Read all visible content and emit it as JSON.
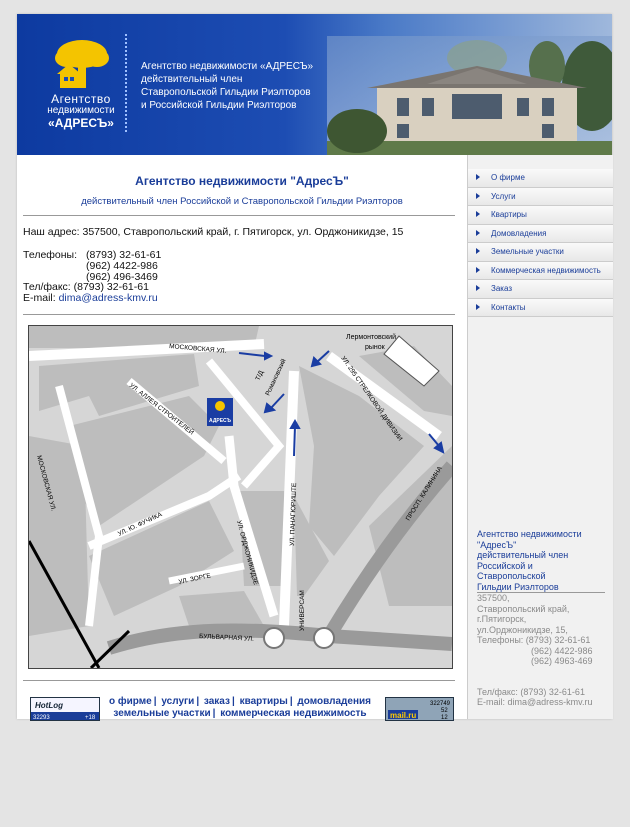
{
  "header": {
    "logo_line1": "Агентство",
    "logo_line2": "недвижимости",
    "logo_line3": "«АДРЕСЪ»",
    "text_lines": [
      "Агентство недвижимости «АДРЕСЪ»",
      "действительный член",
      "Ставропольской Гильдии Риэлторов",
      "и Российской Гильдии Риэлторов"
    ]
  },
  "main": {
    "title": "Агентство недвижимости \"АдресЪ\"",
    "subtitle": "действительный член Российской и Ставропольской Гильдии Риэлторов",
    "address": "Наш адрес: 357500, Ставропольский край, г. Пятигорск, ул. Орджоникидзе, 15",
    "phones_label": "Телефоны:",
    "phones": [
      "(8793) 32-61-61",
      "(962) 4422-986",
      "(962) 496-3469"
    ],
    "fax": "Тел/факс: (8793) 32-61-61",
    "email_label": "E-mail:",
    "email": "dima@adress-kmv.ru"
  },
  "map": {
    "labels": {
      "moskovskaya": "МОСКОВСКАЯ УЛ.",
      "lermontovsky": "Лермонтовский",
      "rynok": "рынок",
      "strelkovoy": "УЛ. 295 СТРЕЛКОВОЙ ДИВИЗИИ",
      "td": "Т/Д",
      "romanovsky": "Романовский",
      "alleya": "УЛ. АЛЛЕЯ СТРОИТЕЛЕЙ",
      "moskovskaya_v": "МОСКОВСКАЯ УЛ.",
      "kalinina": "ПРОСП. КАЛИНИНА",
      "panagyurishte": "УЛ. ПАНАГЮРИШТЕ",
      "fuchika": "УЛ. Ю. ФУЧИКА",
      "ordzhonikidze": "УЛ. ОРДЖОНИКИДЗЕ",
      "zorge": "УЛ. ЗОРГЕ",
      "universam": "УНИВЕРСАМ",
      "bulvarnaya": "БУЛЬВАРНАЯ УЛ.",
      "marker": "АДРЕСЪ"
    }
  },
  "footer": {
    "row1": [
      "о фирме",
      "услуги",
      "заказ",
      "квартиры",
      "домовладения"
    ],
    "row2": [
      "земельные участки",
      "коммерческая недвижимость"
    ],
    "counter1": {
      "name": "HotLog",
      "left": "32293",
      "right": "+18"
    },
    "counter2": {
      "name": "mail.ru",
      "top": "322749",
      "mid": "52",
      "bottom": "12"
    }
  },
  "sidebar": {
    "nav": [
      "О фирме",
      "Услуги",
      "Квартиры",
      "Домовладения",
      "Земельные участки",
      "Коммерческая недвижимость",
      "Заказ",
      "Контакты"
    ],
    "blue_lines": [
      "Агентство недвижимости",
      "\"АдресЪ\"",
      "действительный член",
      "Российской и",
      "Ставропольской",
      "Гильдии Риэлторов"
    ],
    "grey_lines": [
      "357500,",
      "Ставропольский край,",
      "г.Пятигорск,",
      "ул.Орджоникидзе, 15,",
      "Телефоны: (8793) 32-61-61",
      "(962) 4422-986",
      "(962) 4963-469"
    ],
    "fax": "Тел/факс: (8793) 32-61-61",
    "email": "E-mail: dima@adress-kmv.ru"
  }
}
